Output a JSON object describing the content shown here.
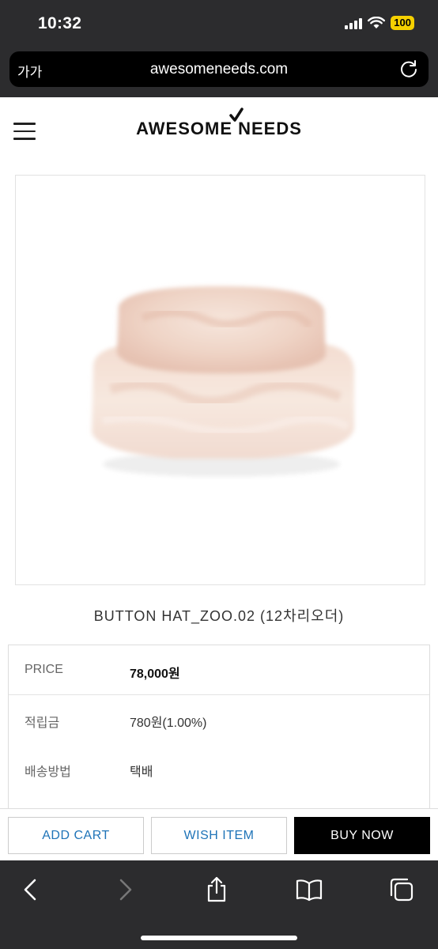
{
  "status": {
    "time": "10:32",
    "battery": "100"
  },
  "browser": {
    "text_size": "가가",
    "url": "awesomeneeds.com"
  },
  "site": {
    "logo": "AWESOME NEEDS"
  },
  "product": {
    "name": "BUTTON HAT_ZOO.02 (12차리오더)",
    "price_label": "PRICE",
    "price_value": "78,000원",
    "points_label": "적립금",
    "points_value": "780원(1.00%)",
    "shipping_label": "배송방법",
    "shipping_value": "택배"
  },
  "actions": {
    "add_cart": "ADD CART",
    "wish_item": "WISH ITEM",
    "buy_now": "BUY NOW"
  },
  "colors": {
    "accent_blue": "#1f74b8",
    "chrome": "#2c2c2e",
    "battery": "#f5d000"
  }
}
